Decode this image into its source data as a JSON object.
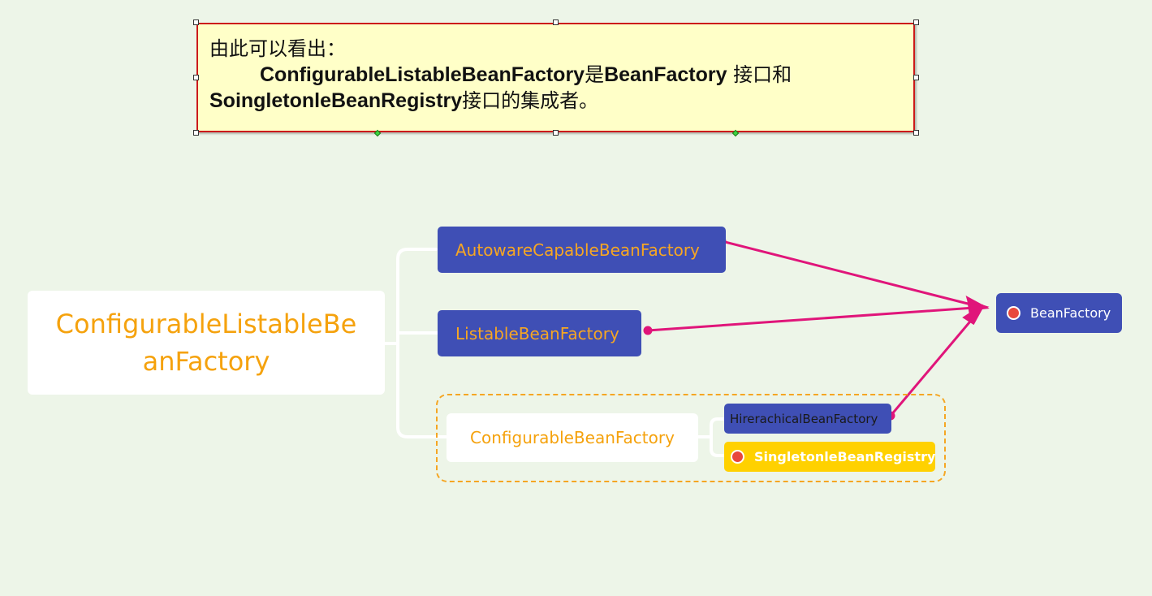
{
  "note": {
    "line1": "由此可以看出：",
    "line2_bold1": "ConfigurableListableBeanFactory",
    "line2_text1": "是",
    "line2_bold2": "BeanFactory",
    "line2_text2": " 接口和",
    "line3_bold1": "SoingletonleBeanRegistry",
    "line3_text1": "接口的集成者。"
  },
  "nodes": {
    "root": "ConfigurableListableBeanFactory",
    "autoware": "AutowareCapableBeanFactory",
    "listable": "ListableBeanFactory",
    "configurable": "ConfigurableBeanFactory",
    "hierarchical": "HirerachicalBeanFactory",
    "singleton": "SingletonleBeanRegistry",
    "beanfactory": "BeanFactory"
  },
  "colors": {
    "background": "#edf5e8",
    "note_fill": "#ffffc8",
    "note_border": "#cc1a1a",
    "node_blue": "#3f4fb5",
    "node_text_orange": "#f5a20d",
    "node_yellow": "#ffd100",
    "arrow": "#e0157a",
    "dot": "#e8483c",
    "dash_border": "#f5a623"
  }
}
